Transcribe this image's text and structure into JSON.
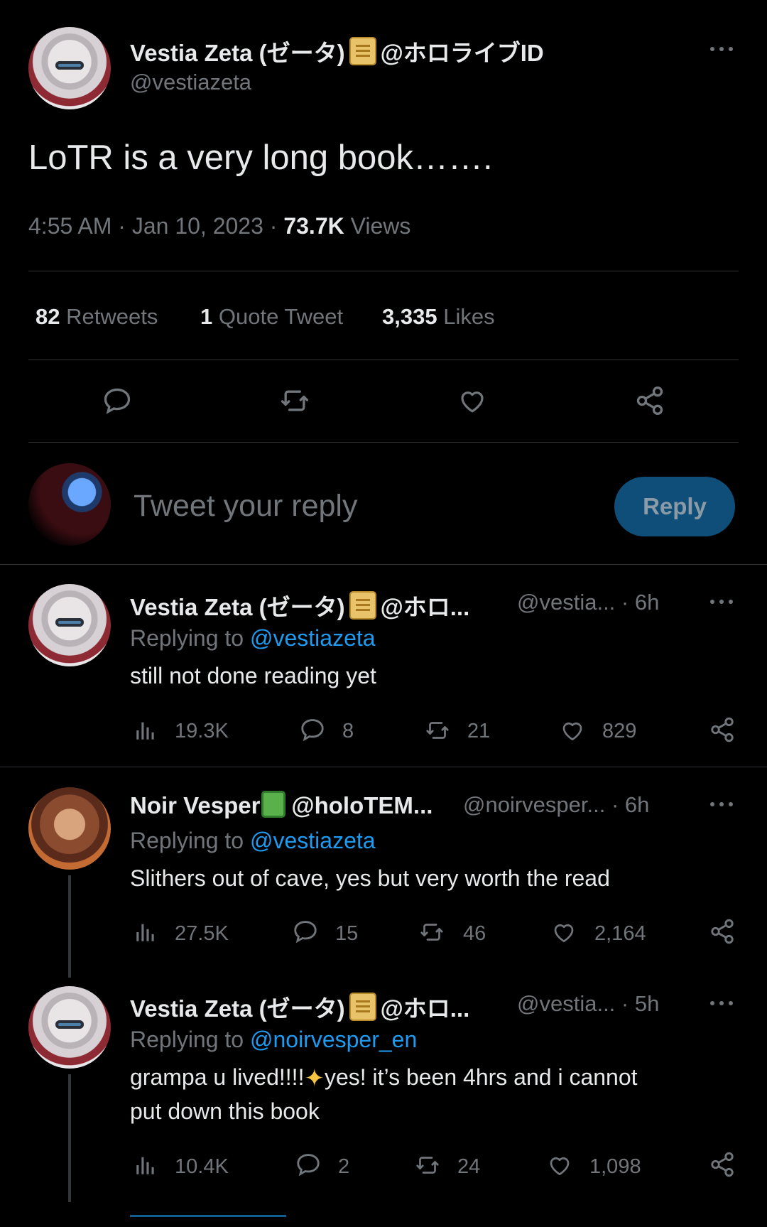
{
  "main_tweet": {
    "display_name": "Vestia Zeta (ゼータ)",
    "affiliation": "@ホロライブID",
    "handle": "@vestiazeta",
    "text": "LoTR is a very long book…….",
    "time": "4:55 AM",
    "date": "Jan 10, 2023",
    "views_count": "73.7K",
    "views_label": "Views",
    "retweets_count": "82",
    "retweets_label": "Retweets",
    "quotes_count": "1",
    "quotes_label": "Quote Tweet",
    "likes_count": "3,335",
    "likes_label": "Likes"
  },
  "composer": {
    "placeholder": "Tweet your reply",
    "reply_label": "Reply"
  },
  "replies": [
    {
      "display_name": "Vestia Zeta (ゼータ)",
      "affiliation": "@ホロ...",
      "handle": "@vestia...",
      "time": "6h",
      "replying_prefix": "Replying to",
      "replying_to": "@vestiazeta",
      "text": "still not done reading yet",
      "views": "19.3K",
      "replies": "8",
      "retweets": "21",
      "likes": "829"
    },
    {
      "display_name": "Noir Vesper",
      "affiliation": "@holoTEM...",
      "handle": "@noirvesper...",
      "time": "6h",
      "replying_prefix": "Replying to",
      "replying_to": "@vestiazeta",
      "text": "Slithers out of cave, yes but very worth the read",
      "views": "27.5K",
      "replies": "15",
      "retweets": "46",
      "likes": "2,164"
    },
    {
      "display_name": "Vestia Zeta (ゼータ)",
      "affiliation": "@ホロ...",
      "handle": "@vestia...",
      "time": "5h",
      "replying_prefix": "Replying to",
      "replying_to": "@noirvesper_en",
      "text_part1": "grampa u lived!!!!",
      "text_part2": "yes! it’s been 4hrs and i cannot",
      "text_line2": "put down this book",
      "views": "10.4K",
      "replies": "2",
      "retweets": "24",
      "likes": "1,098"
    }
  ]
}
